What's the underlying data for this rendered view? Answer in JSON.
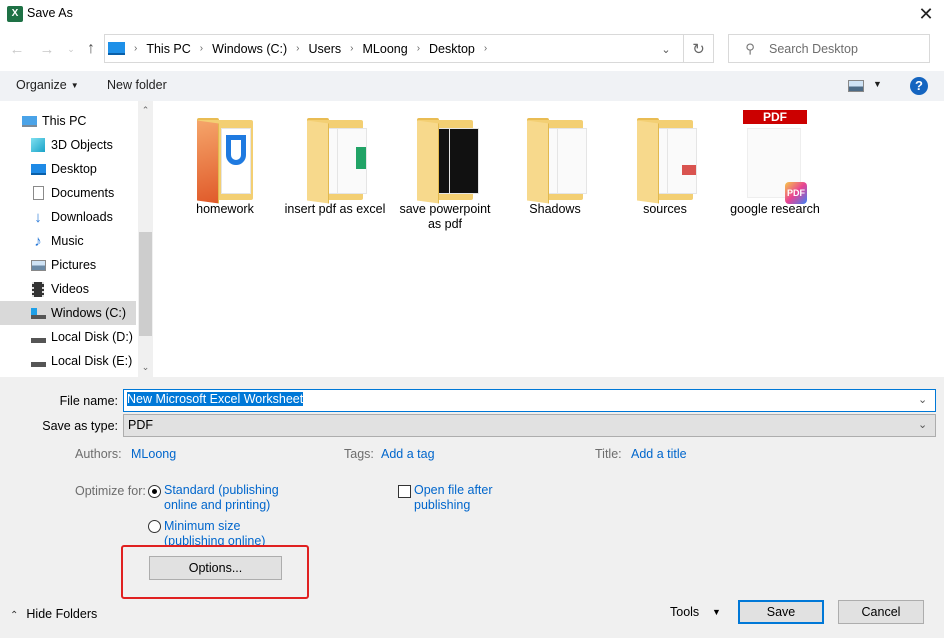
{
  "window": {
    "title": "Save As",
    "app_icon_letter": "X",
    "close_glyph": "✕"
  },
  "nav_buttons": {
    "back": "←",
    "forward": "→",
    "recent": "⌄",
    "up": "↑"
  },
  "breadcrumb": [
    "This PC",
    "Windows (C:)",
    "Users",
    "MLoong",
    "Desktop"
  ],
  "breadcrumb_separator": "›",
  "address_dropdown": "⌄",
  "refresh_glyph": "↻",
  "search": {
    "placeholder": "Search Desktop",
    "icon": "⚲"
  },
  "toolbar": {
    "organize": "Organize",
    "organize_caret": "▼",
    "new_folder": "New folder",
    "view_caret": "▼",
    "help": "?"
  },
  "nav_pane": {
    "items": [
      {
        "label": "This PC",
        "icon": "computer-icon",
        "selected": false
      },
      {
        "label": "3D Objects",
        "icon": "cube-icon",
        "selected": false
      },
      {
        "label": "Desktop",
        "icon": "desktop-icon",
        "selected": false
      },
      {
        "label": "Documents",
        "icon": "document-icon",
        "selected": false
      },
      {
        "label": "Downloads",
        "icon": "download-icon",
        "selected": false
      },
      {
        "label": "Music",
        "icon": "music-icon",
        "selected": false
      },
      {
        "label": "Pictures",
        "icon": "pictures-icon",
        "selected": false
      },
      {
        "label": "Videos",
        "icon": "video-icon",
        "selected": false
      },
      {
        "label": "Windows (C:)",
        "icon": "windows-drive-icon",
        "selected": true
      },
      {
        "label": "Local Disk (D:)",
        "icon": "drive-icon",
        "selected": false
      },
      {
        "label": "Local Disk (E:)",
        "icon": "drive-icon",
        "selected": false
      }
    ],
    "scroll_up": "⌃",
    "scroll_down": "⌄"
  },
  "files": [
    {
      "name": "homework",
      "type": "folder"
    },
    {
      "name": "insert pdf as excel",
      "type": "folder"
    },
    {
      "name": "save powerpoint as pdf",
      "type": "folder"
    },
    {
      "name": "Shadows",
      "type": "folder"
    },
    {
      "name": "sources",
      "type": "folder"
    },
    {
      "name": "google research",
      "type": "pdf",
      "badge": "PDF"
    }
  ],
  "form": {
    "file_name_label": "File name:",
    "file_name_value": "New Microsoft Excel Worksheet",
    "save_type_label": "Save as type:",
    "save_type_value": "PDF",
    "dropdown_glyph": "⌄",
    "authors_label": "Authors:",
    "authors_value": "MLoong",
    "tags_label": "Tags:",
    "tags_value": "Add a tag",
    "title_label": "Title:",
    "title_value": "Add a title",
    "optimize_label": "Optimize for:",
    "optimize_options": [
      {
        "label": "Standard (publishing online and printing)",
        "checked": true
      },
      {
        "label": "Minimum size (publishing online)",
        "checked": false
      }
    ],
    "open_after_label": "Open file after publishing",
    "open_after_checked": false,
    "options_button": "Options..."
  },
  "footer": {
    "hide_folders": "Hide Folders",
    "hide_chevron": "⌃",
    "tools": "Tools",
    "tools_caret": "▼",
    "save": "Save",
    "cancel": "Cancel"
  },
  "colors": {
    "accent": "#0078d7",
    "link": "#0066cc",
    "highlight_box": "#e02020",
    "selection": "#0078d7",
    "excel_green": "#1e7145"
  }
}
